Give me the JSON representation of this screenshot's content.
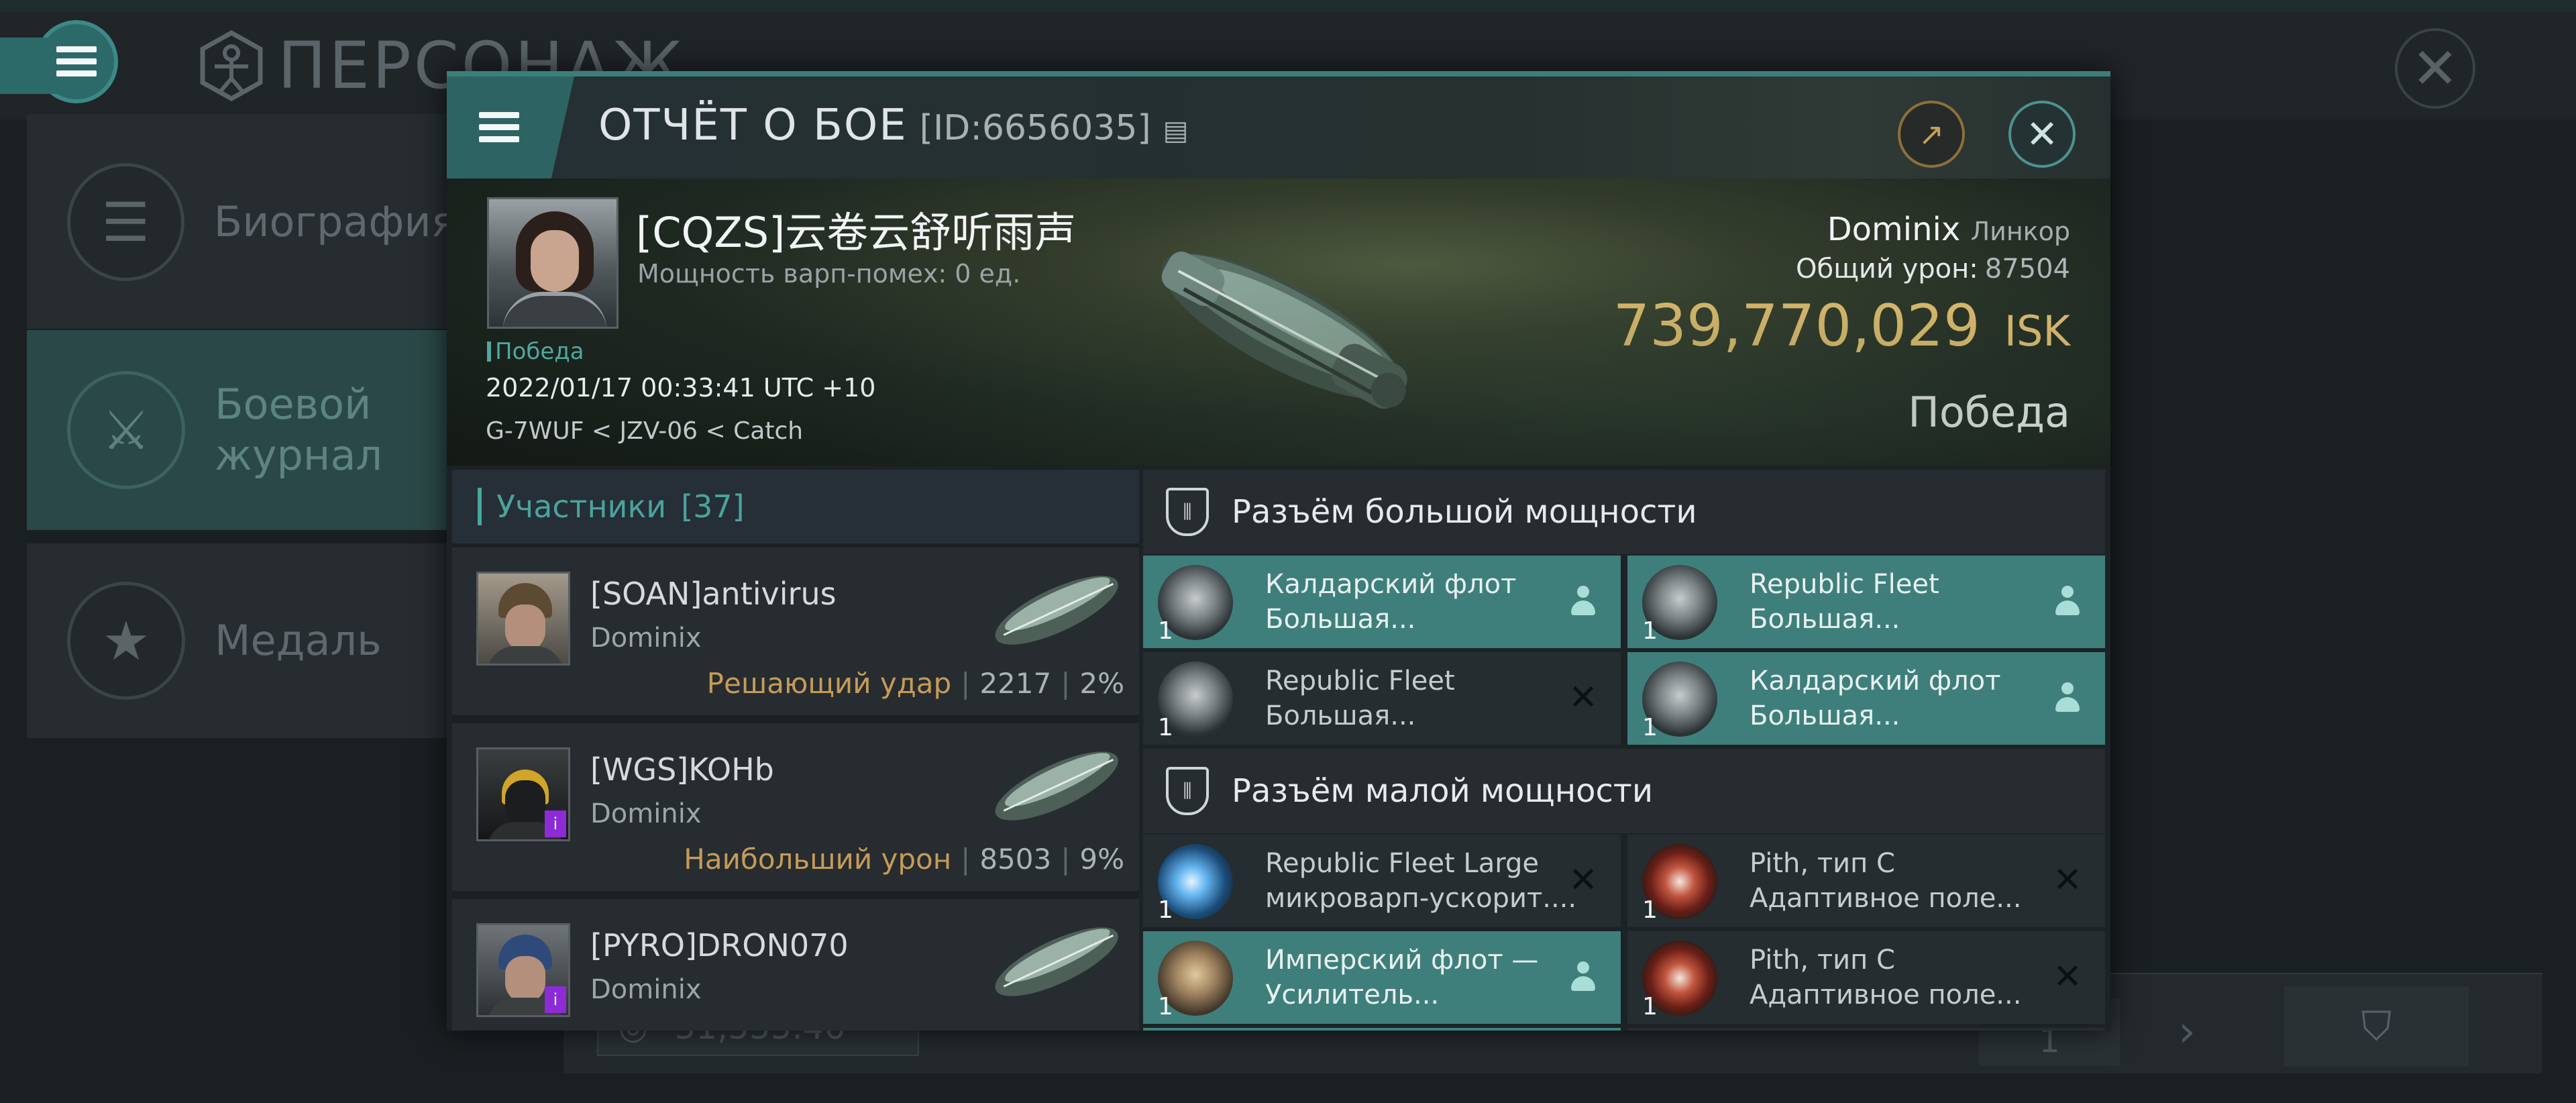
{
  "background": {
    "title": "ПЕРСОНАЖ",
    "sidebar": [
      {
        "label_line1": "Биография",
        "label_line2": "",
        "icon": "list-icon"
      },
      {
        "label_line1": "Боевой",
        "label_line2": "журнал",
        "icon": "crossed-swords-icon"
      },
      {
        "label_line1": "Медаль",
        "label_line2": "",
        "icon": "star-medal-icon"
      }
    ],
    "money": "51,555.46",
    "page_number": "1"
  },
  "report": {
    "title": "ОТЧЁТ О БОЕ",
    "id": "[ID:6656035]",
    "pilot": {
      "name": "[CQZS]云卷云舒听雨声",
      "warp_interference": "Мощность варп-помех: 0 ед.",
      "status": "Победа",
      "datetime": "2022/01/17 00:33:41 UTC +10",
      "route": "G-7WUF < JZV-06 < Catch"
    },
    "ship": {
      "name": "Dominix",
      "class": "Линкор",
      "damage_label": "Общий урон:",
      "damage_value": "87504",
      "isk_value": "739,770,029",
      "isk_unit": "ISK",
      "result": "Победа"
    },
    "participants": {
      "label": "Участники",
      "count": "[37]",
      "rows": [
        {
          "name": "[SOAN]antivirus",
          "ship": "Dominix",
          "role": "Решающий удар",
          "damage": "2217",
          "percent": "2%",
          "badge": ""
        },
        {
          "name": "[WGS]KOHb",
          "ship": "Dominix",
          "role": "Наибольший урон",
          "damage": "8503",
          "percent": "9%",
          "badge": "i"
        },
        {
          "name": "[PYRO]DRON070",
          "ship": "Dominix",
          "role": "",
          "damage": "",
          "percent": "",
          "badge": "i"
        }
      ]
    },
    "high_slots": {
      "label": "Разъём большой мощности",
      "modules": [
        {
          "line1": "Калдарский флот",
          "line2": "Большая...",
          "qty": "1",
          "fitted": true,
          "icon": "turret-icon"
        },
        {
          "line1": "Republic Fleet",
          "line2": "Большая...",
          "qty": "1",
          "fitted": true,
          "icon": "turret-icon"
        },
        {
          "line1": "Republic Fleet",
          "line2": "Большая...",
          "qty": "1",
          "fitted": false,
          "icon": "turret-icon"
        },
        {
          "line1": "Калдарский флот",
          "line2": "Большая...",
          "qty": "1",
          "fitted": true,
          "icon": "turret-icon"
        }
      ]
    },
    "mid_slots": {
      "label": "Разъём малой мощности",
      "modules": [
        {
          "line1": "Republic Fleet Large",
          "line2": "микроварп-ускорит....",
          "qty": "1",
          "fitted": false,
          "icon": "microwarp-icon"
        },
        {
          "line1": "Pith, тип C",
          "line2": "Адаптивное поле...",
          "qty": "1",
          "fitted": false,
          "icon": "shield-field-icon"
        },
        {
          "line1": "Имперский флот —",
          "line2": "Усилитель...",
          "qty": "1",
          "fitted": true,
          "icon": "dish-icon"
        },
        {
          "line1": "Pith, тип C",
          "line2": "Адаптивное поле...",
          "qty": "1",
          "fitted": false,
          "icon": "shield-field-icon"
        }
      ]
    }
  },
  "colors": {
    "accent": "#3e7f7c",
    "isk": "#e6c170",
    "role": "#c69b58",
    "teal_text": "#4aa39c"
  }
}
